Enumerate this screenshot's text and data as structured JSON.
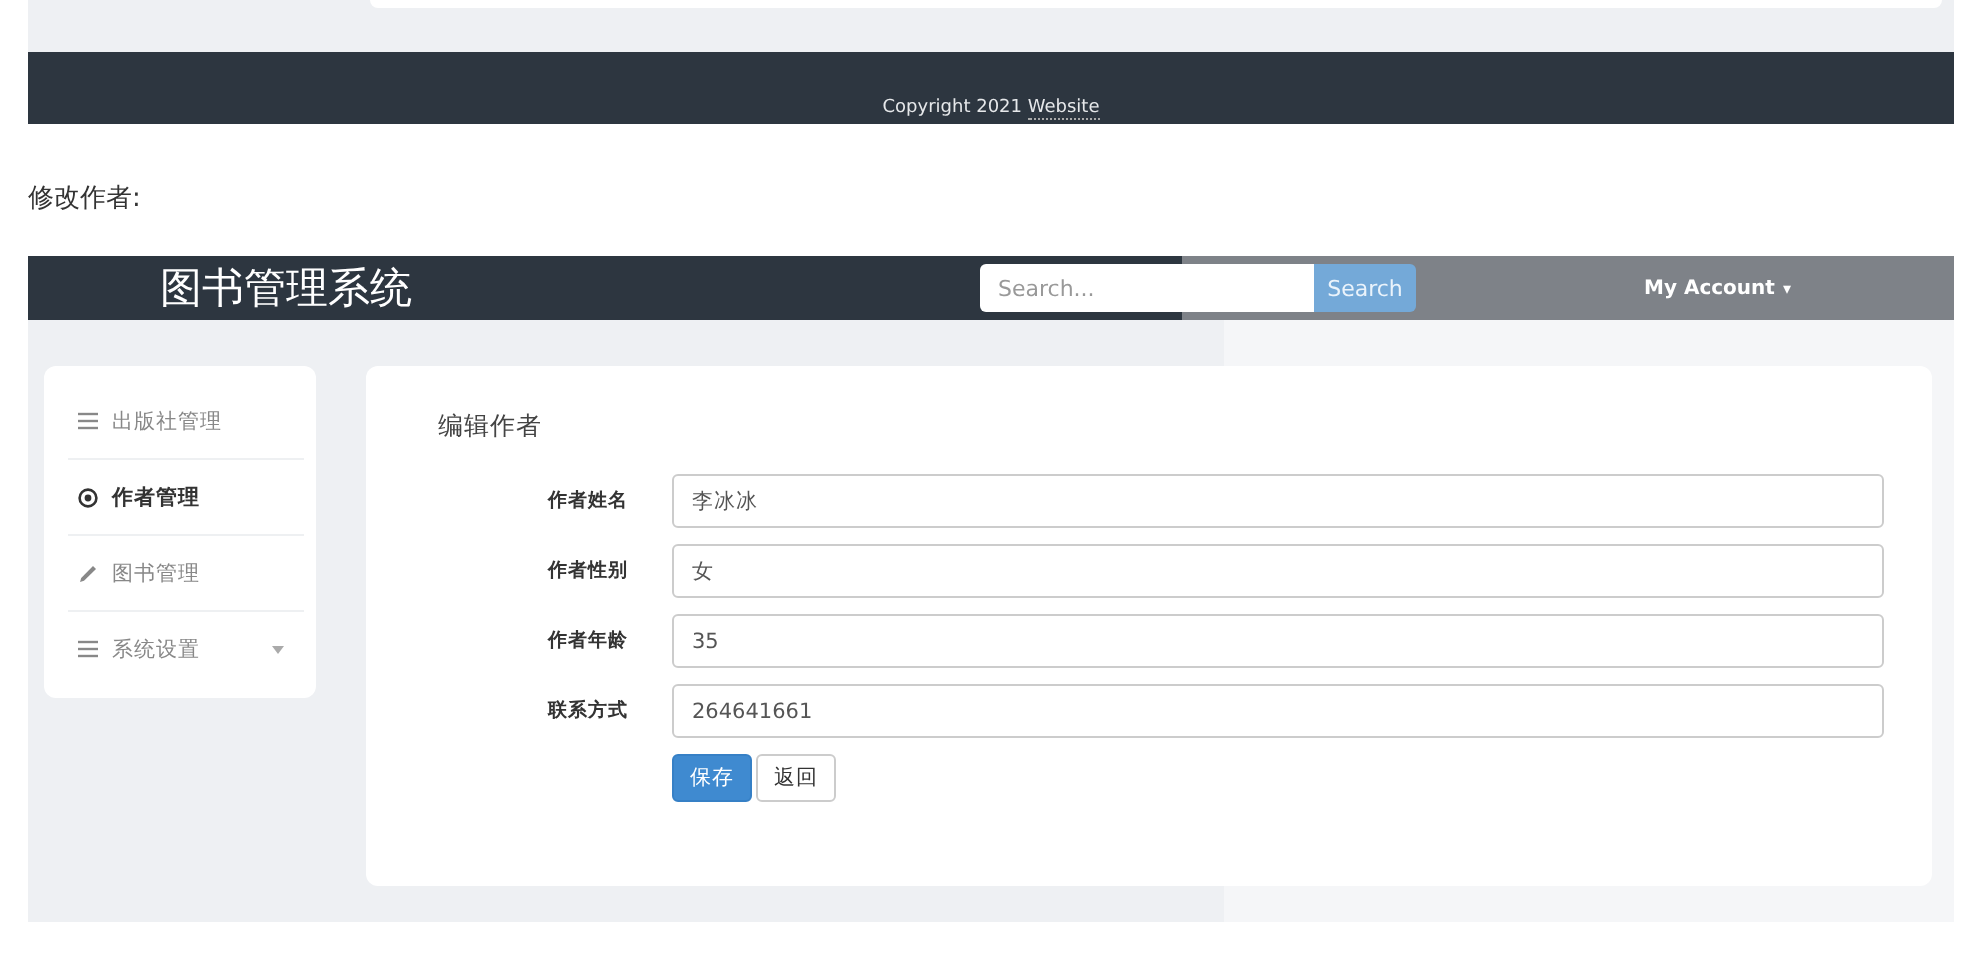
{
  "top_footer": {
    "copyright": "Copyright 2021 ",
    "link": "Website"
  },
  "caption": "修改作者:",
  "app": {
    "brand": "图书管理系统",
    "search": {
      "placeholder": "Search...",
      "button": "Search"
    },
    "account": {
      "label": "My Account",
      "caret": "▾"
    },
    "sidebar": [
      {
        "kind": "list",
        "label": "出版社管理",
        "selected": false,
        "has_submenu": false
      },
      {
        "kind": "target",
        "label": "作者管理",
        "selected": true,
        "has_submenu": false
      },
      {
        "kind": "pencil",
        "label": "图书管理",
        "selected": false,
        "has_submenu": false
      },
      {
        "kind": "list",
        "label": "系统设置",
        "selected": false,
        "has_submenu": true
      }
    ],
    "form": {
      "title": "编辑作者",
      "fields": [
        {
          "label": "作者姓名",
          "value": "李冰冰"
        },
        {
          "label": "作者性别",
          "value": "女"
        },
        {
          "label": "作者年龄",
          "value": "35"
        },
        {
          "label": "联系方式",
          "value": "264641661"
        }
      ],
      "buttons": [
        {
          "kind": "primary",
          "label": "保存"
        },
        {
          "kind": "default",
          "label": "返回"
        }
      ]
    }
  }
}
